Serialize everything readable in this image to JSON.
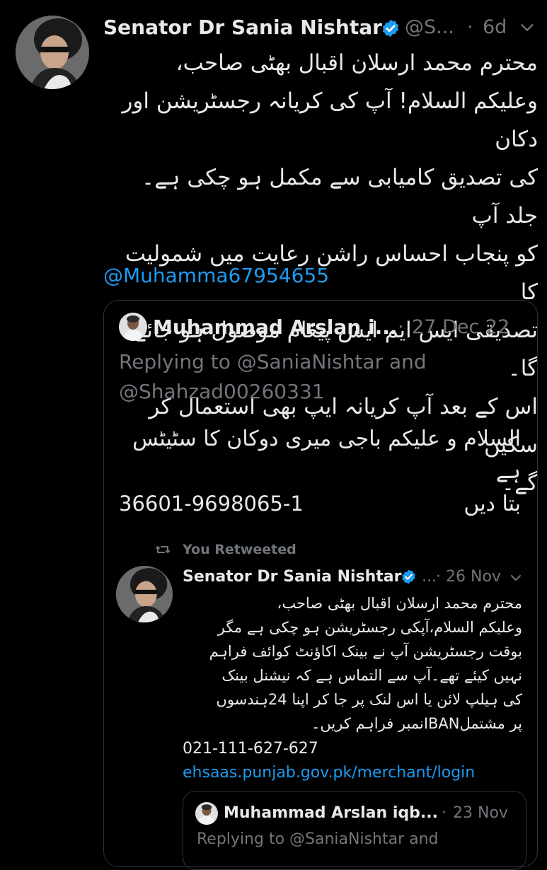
{
  "main_tweet": {
    "author_name": "Senator Dr Sania Nishtar",
    "handle": "@S...",
    "separator": "·",
    "time": "6d",
    "more_icon": "chevron-down-icon",
    "lines": [
      "محترم محمد ارسلان اقبال بھٹی صاحب،",
      "وعلیکم السلام! آپ کی کریانہ رجسٹریشن اور دکان",
      "کی تصدیق کامیابی سے مکمل ہو چکی ہے۔ جلد آپ",
      "کو پنجاب احساس راشن رعایت میں شمولیت کا",
      "تصدیقی ایس ایم ایس پیغام موصول ہو جائے گا۔",
      "اس کے بعد آپ کریانہ ایپ بھی استعمال کر سکیں",
      "گے۔"
    ],
    "mention": "@Muhamma67954655"
  },
  "quoted_tweet": {
    "author_name": "Muhammad Arslan i...",
    "separator": "·",
    "date": "27 Dec 22",
    "replying_line1": "Replying to @SaniaNishtar and",
    "replying_line2": "@Shahzad00260331",
    "lines": [
      "السلام و علیکم باجی میری دوکان کا سٹیٹس ہے",
      "بتا دیں"
    ],
    "cnic": "36601-9698065-1"
  },
  "retweeted_tweet": {
    "retweet_label": "You Retweeted",
    "author_name": "Senator Dr Sania Nishtar",
    "handle": "...",
    "separator": "·",
    "date": "26 Nov",
    "lines": [
      "محترم محمد ارسلان اقبال بھٹی صاحب،",
      "وعلیکم السلام،آپکی رجسٹریشن ہو چکی ہے مگر",
      "بوقت رجسٹریشن آپ نے بینک اکاؤنٹ کوائف فراہم",
      "نہیں کیئے تھے۔آپ سے التماس ہے کہ نیشنل بینک",
      "کی ہیلپ لائن یا اس لنک پر جا کر اپنا 24ہندسوں",
      "پر مشتملIBANنمبر فراہم کریں۔"
    ],
    "phone": "021-111-627-627",
    "url": "ehsaas.punjab.gov.pk/merchant/login"
  },
  "nested_quote": {
    "author_name": "Muhammad Arslan iqb...",
    "separator": "·",
    "date": "23 Nov",
    "replying": "Replying to @SaniaNishtar and"
  },
  "colors": {
    "background": "#000000",
    "text": "#e7e9ea",
    "muted": "#71767b",
    "link": "#1d9bf0",
    "verified": "#1d9bf0",
    "border": "#2f3336"
  }
}
